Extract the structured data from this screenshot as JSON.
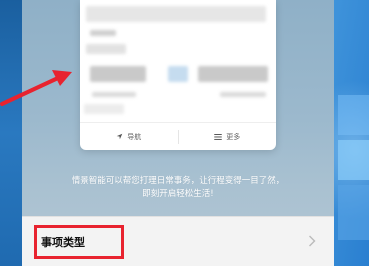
{
  "card": {
    "nav_label": "导航",
    "more_label": "更多"
  },
  "description": {
    "line1": "情景智能可以帮您打理日常事务，让行程变得一目了然，",
    "line2": "即刻开启轻松生活!"
  },
  "type_row": {
    "label": "事项类型"
  },
  "colors": {
    "highlight_border": "#e8232f",
    "arrow": "#e8232f"
  },
  "icons": {
    "nav": "navigation-arrow-icon",
    "more": "menu-lines-icon",
    "row_chevron": "chevron-right-icon"
  }
}
